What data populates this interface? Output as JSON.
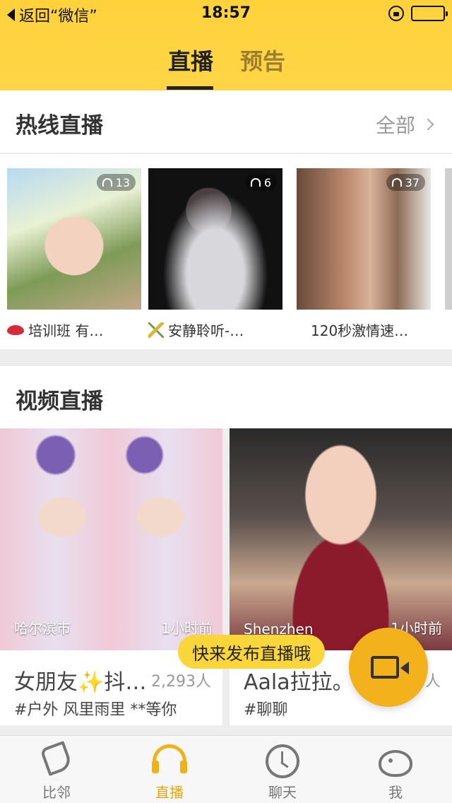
{
  "status_bar": {
    "back_label": "返回“微信”",
    "time": "18:57"
  },
  "tabs": [
    {
      "label": "直播",
      "active": true
    },
    {
      "label": "预告",
      "active": false
    }
  ],
  "hot": {
    "title": "热线直播",
    "more": "全部",
    "items": [
      {
        "viewers": "13",
        "caption": "培训班 有…",
        "icon": "lips-icon"
      },
      {
        "viewers": "6",
        "caption": "安静聆听-…",
        "icon": "rice-icon"
      },
      {
        "viewers": "37",
        "caption": "120秒激情速…",
        "icon": ""
      }
    ]
  },
  "video": {
    "title": "视频直播",
    "items": [
      {
        "location": "哈尔滨市",
        "time": "1小时前",
        "title_a": "女朋友",
        "title_b": "抖…",
        "count": "2,293人",
        "tags": "#户外 风里雨里 **等你"
      },
      {
        "location": "Shenzhen",
        "time": "1小时前",
        "title_a": "Aala拉拉。",
        "title_b": "",
        "count": "人",
        "tags": "#聊聊"
      }
    ]
  },
  "floating": {
    "bubble": "快来发布直播哦",
    "fab_icon": "camera-icon"
  },
  "bottom_nav": [
    {
      "label": "比邻",
      "icon": "phone-icon",
      "active": false
    },
    {
      "label": "直播",
      "icon": "headset-icon",
      "active": true
    },
    {
      "label": "聊天",
      "icon": "clock-icon",
      "active": false
    },
    {
      "label": "我",
      "icon": "bird-icon",
      "active": false
    }
  ],
  "colors": {
    "header_yellow": "#ffd23c",
    "accent": "#f3b21c",
    "active_nav": "#e8a712"
  }
}
